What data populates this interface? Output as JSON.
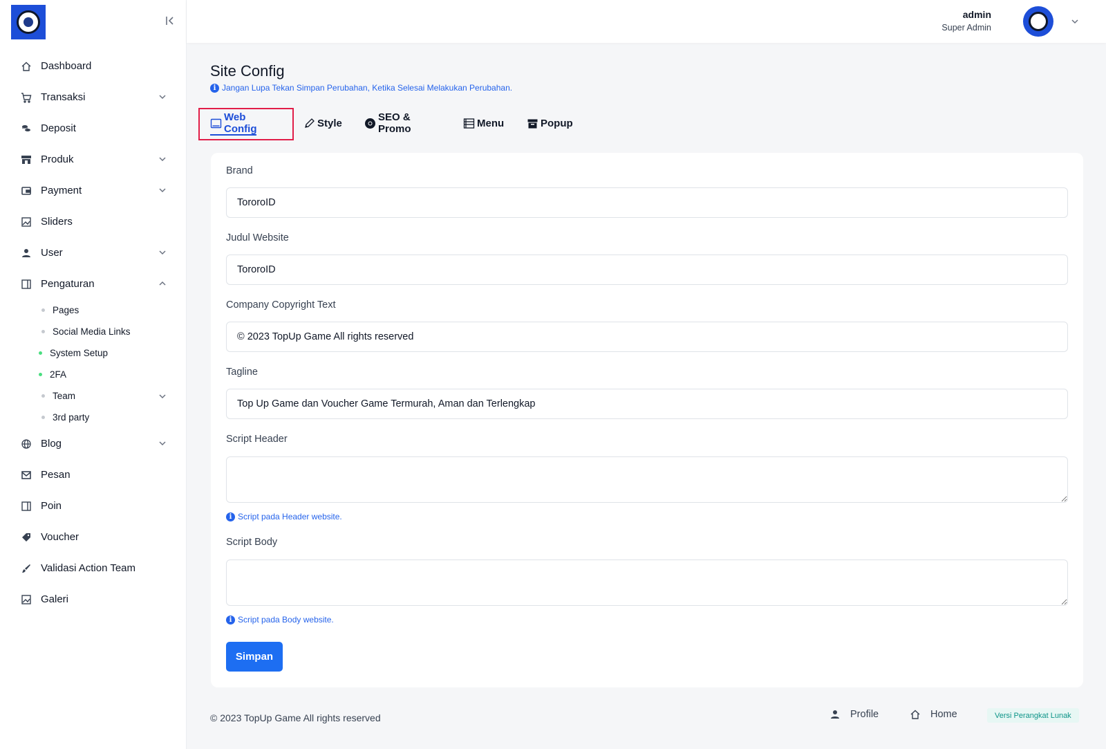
{
  "sidebar": {
    "logo_icon": "game-mascot-logo",
    "collapse_icon": "collapse-left-icon",
    "items": [
      {
        "label": "Dashboard",
        "icon": "home-icon"
      },
      {
        "label": "Transaksi",
        "icon": "cart-icon",
        "expandable": true
      },
      {
        "label": "Deposit",
        "icon": "coins-icon"
      },
      {
        "label": "Produk",
        "icon": "store-icon",
        "expandable": true
      },
      {
        "label": "Payment",
        "icon": "wallet-icon",
        "expandable": true
      },
      {
        "label": "Sliders",
        "icon": "image-icon"
      },
      {
        "label": "User",
        "icon": "user-icon",
        "expandable": true
      },
      {
        "label": "Pengaturan",
        "icon": "panel-icon",
        "expanded": true
      },
      {
        "label": "Blog",
        "icon": "globe-icon",
        "expandable": true
      },
      {
        "label": "Pesan",
        "icon": "mail-icon"
      },
      {
        "label": "Poin",
        "icon": "panel-icon"
      },
      {
        "label": "Voucher",
        "icon": "tag-icon"
      },
      {
        "label": "Validasi Action Team",
        "icon": "brush-icon"
      },
      {
        "label": "Galeri",
        "icon": "image-icon"
      }
    ],
    "pengaturan_sub": [
      {
        "label": "Pages"
      },
      {
        "label": "Social Media Links"
      },
      {
        "label": "System Setup"
      },
      {
        "label": "2FA"
      },
      {
        "label": "Team"
      },
      {
        "label": "3rd party"
      }
    ]
  },
  "header": {
    "user_name": "admin",
    "user_role": "Super Admin"
  },
  "main": {
    "title": "Site Config",
    "note": "Jangan Lupa Tekan Simpan Perubahan, Ketika Selesai Melakukan Perubahan.",
    "tabs": [
      {
        "label": "Web Config",
        "icon": "window-icon"
      },
      {
        "label": "Style",
        "icon": "pen-icon"
      },
      {
        "label": "SEO & Promo",
        "icon": "chrome-icon"
      },
      {
        "label": "Menu",
        "icon": "list-icon"
      },
      {
        "label": "Popup",
        "icon": "archive-icon"
      }
    ],
    "form": {
      "brand_label": "Brand",
      "brand_value": "TororoID",
      "judul_label": "Judul Website",
      "judul_value": "TororoID",
      "copyright_label": "Company Copyright Text",
      "copyright_value": "© 2023 TopUp Game All rights reserved",
      "tagline_label": "Tagline",
      "tagline_value": "Top Up Game dan Voucher Game Termurah, Aman dan Terlengkap",
      "script_header_label": "Script Header",
      "script_header_value": "",
      "script_header_hint": "Script pada Header website.",
      "script_body_label": "Script Body",
      "script_body_value": "",
      "script_body_hint": "Script pada Body website.",
      "save_label": "Simpan"
    }
  },
  "footer": {
    "copyright": "© 2023 TopUp Game All rights reserved",
    "profile_label": "Profile",
    "home_label": "Home",
    "version_label": "Versi Perangkat Lunak"
  },
  "colors": {
    "accent": "#1d6ef2",
    "active_tab": "#1d4ed8",
    "highlight": "#e11d48"
  }
}
